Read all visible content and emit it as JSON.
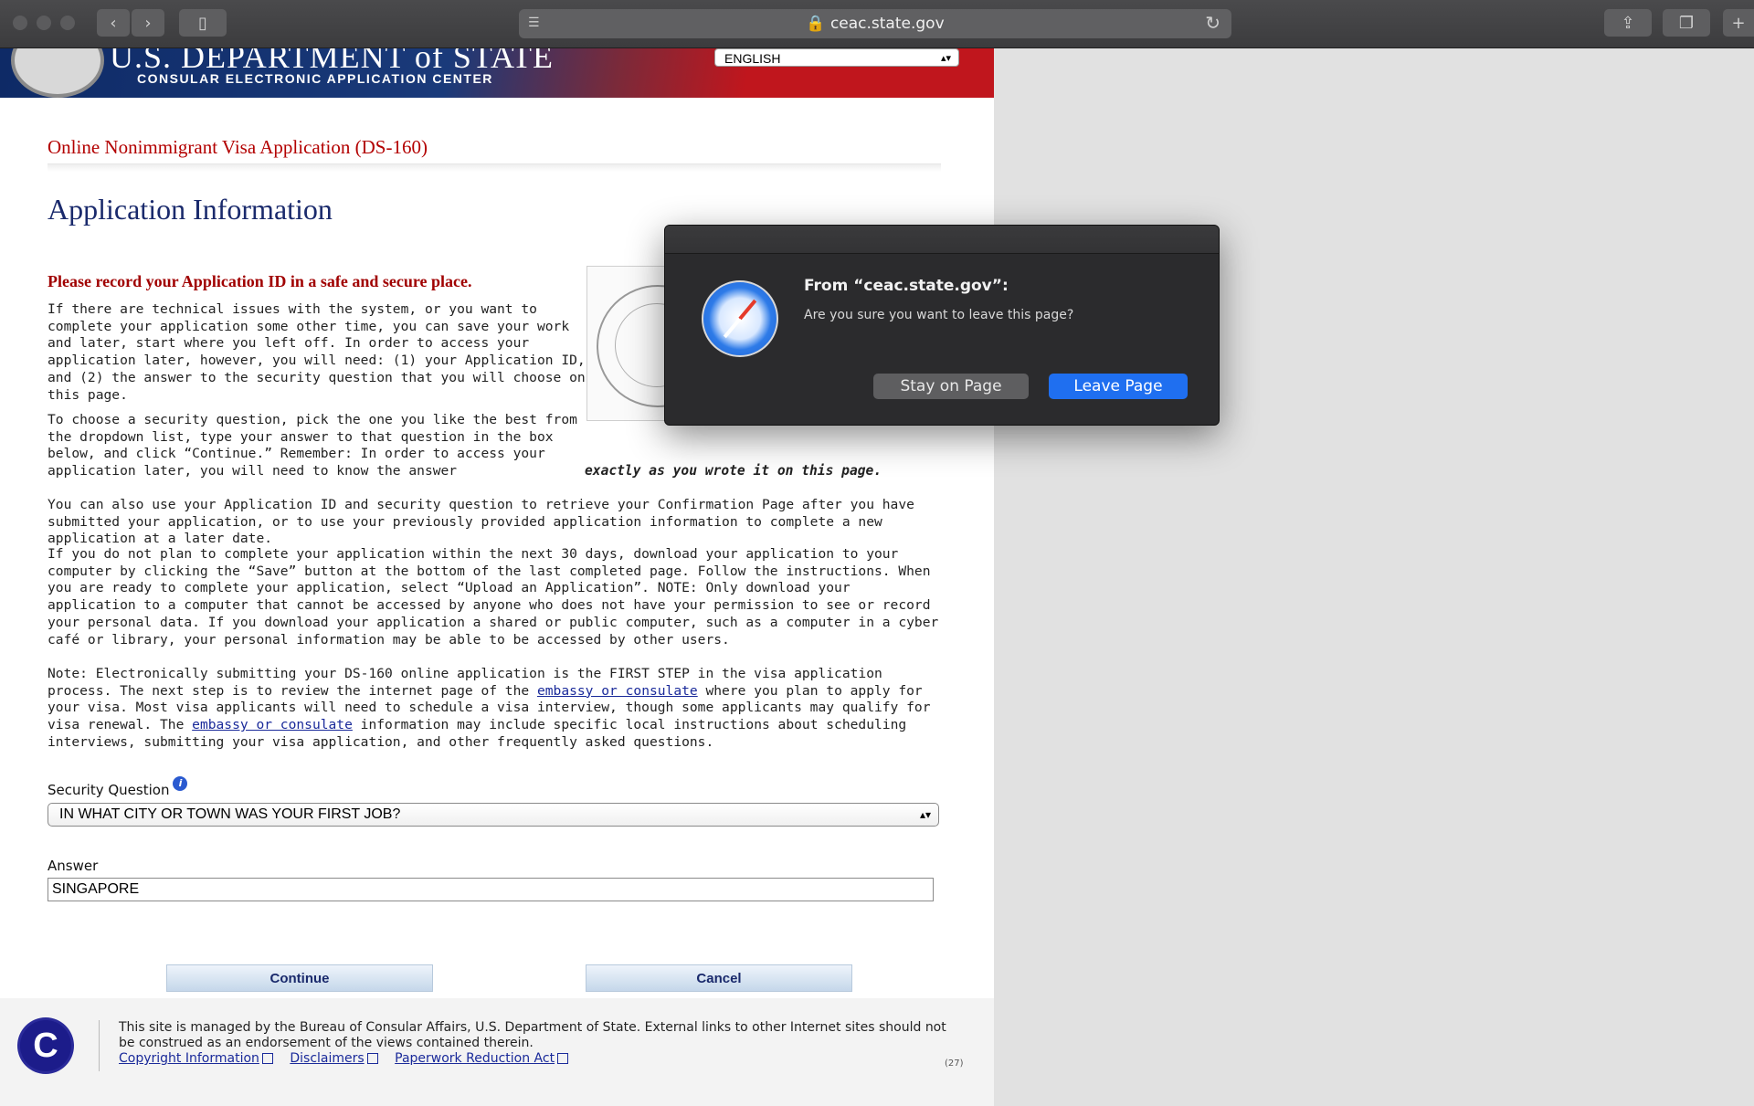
{
  "browser": {
    "url": "ceac.state.gov"
  },
  "header": {
    "title": "U.S. DEPARTMENT of STATE",
    "subtitle": "CONSULAR ELECTRONIC APPLICATION CENTER",
    "language": "ENGLISH"
  },
  "main": {
    "form_title": "Online Nonimmigrant Visa Application (DS-160)",
    "page_title": "Application Information",
    "notice": "Please record your Application ID in a safe and secure place.",
    "p1": "If there are technical issues with the system, or you want to complete your application some other time, you can save your work and later, start where you left off. In order to access your application later, however, you will need: (1) your Application ID, and (2) the answer to the security question that you will choose on this page.",
    "p2_a": "To choose a security question, pick the one you like the best from the dropdown list, type your answer to that question in the box below, and click “Continue.” Remember: In order to access your application later, you will need to know the answer ",
    "p2_b": "exactly as you wrote it on this page.",
    "p3": "You can also use your Application ID and security question to retrieve your Confirmation Page after you have submitted your application, or to use your previously provided application information to complete a new application at a later date.",
    "p4": "If you do not plan to complete your application within the next 30 days, download your application to your computer by clicking the “Save” button at the bottom of the last completed page. Follow the instructions. When you are ready to complete your application, select “Upload an Application”. NOTE: Only download your application to a computer that cannot be accessed by anyone who does not have your permission to see or record your personal data. If you download your application a shared or public computer, such as a computer in a cyber café or library, your personal information may be able to be accessed by other users.",
    "p5_a": "Note: Electronically submitting your DS-160 online application is the FIRST STEP in the visa application process. The next step is to review the internet page of the ",
    "p5_link1": "embassy or consulate",
    "p5_b": " where you plan to apply for your visa. Most visa applicants will need to schedule a visa interview, though some applicants may qualify for visa renewal. The ",
    "p5_link2": "embassy or consulate",
    "p5_c": " information may include specific local instructions about scheduling interviews, submitting your visa application, and other frequently asked questions.",
    "security_label": "Security Question",
    "security_value": "IN WHAT CITY OR TOWN WAS YOUR FIRST JOB?",
    "answer_label": "Answer",
    "answer_value": "SINGAPORE",
    "continue_label": "Continue",
    "cancel_label": "Cancel"
  },
  "footer": {
    "text": "This site is managed by the Bureau of Consular Affairs, U.S. Department of State. External links to other Internet sites should not be construed as an endorsement of the views contained therein.",
    "links": [
      "Copyright Information",
      "Disclaimers",
      "Paperwork Reduction Act"
    ],
    "code": "(27)",
    "logo_letter": "C"
  },
  "dialog": {
    "title": "From “ceac.state.gov”:",
    "message": "Are you sure you want to leave this page?",
    "stay_label": "Stay on Page",
    "leave_label": "Leave Page"
  },
  "colors": {
    "accent_blue": "#1f6ff0",
    "title_red": "#b30000",
    "heading_navy": "#1a2a6c"
  }
}
